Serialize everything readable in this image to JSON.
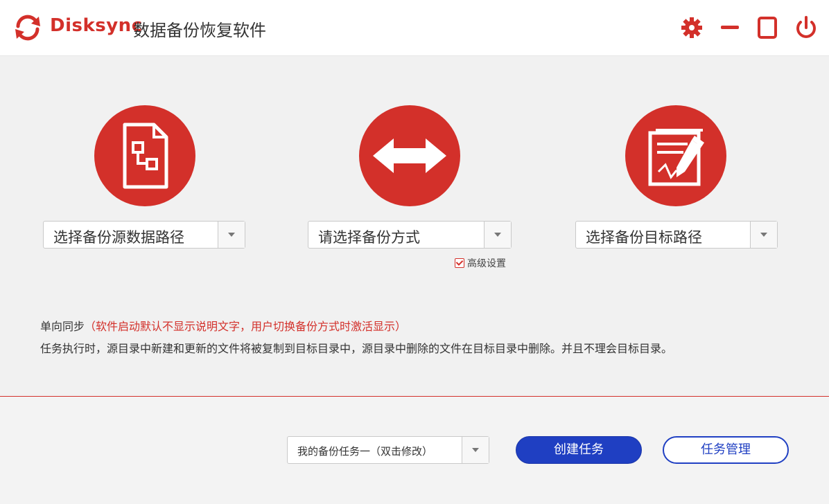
{
  "app": {
    "brand": "Disksync",
    "subtitle": "数据备份恢复软件",
    "accent_color": "#d3302a",
    "button_color": "#1f3fc2"
  },
  "titlebar": {
    "icons": [
      "refresh-logo-icon",
      "gear-icon",
      "minimize-icon",
      "maximize-icon",
      "power-icon"
    ]
  },
  "steps": [
    {
      "icon": "source-file-icon",
      "select_label": "选择备份源数据路径"
    },
    {
      "icon": "double-arrow-icon",
      "select_label": "请选择备份方式"
    },
    {
      "icon": "edit-document-icon",
      "select_label": "选择备份目标路径"
    }
  ],
  "advanced": {
    "label": "高级设置",
    "checked": true
  },
  "description": {
    "mode": "单向同步",
    "note": "（软件启动默认不显示说明文字，用户切换备份方式时激活显示）",
    "text": "任务执行时，源目录中新建和更新的文件将被复制到目标目录中，源目录中删除的文件在目标目录中删除。并且不理会目标目录。"
  },
  "footer": {
    "task_name": "我的备份任务一（双击修改）",
    "create_button": "创建任务",
    "manage_button": "任务管理"
  }
}
